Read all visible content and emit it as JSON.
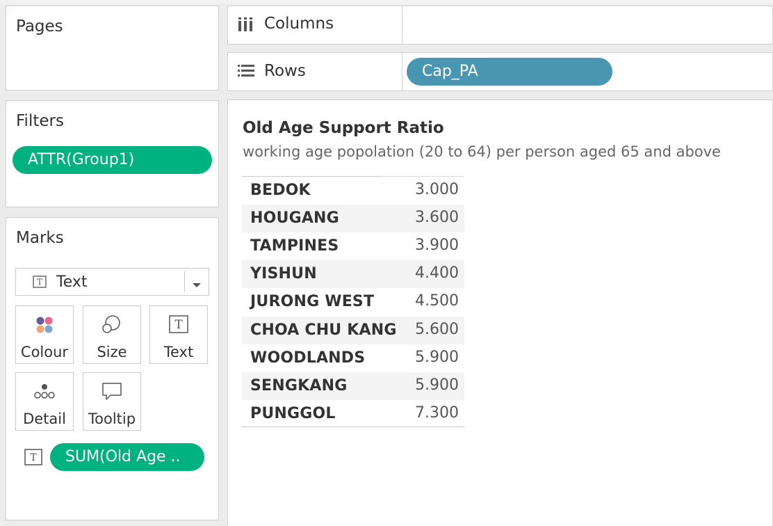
{
  "pages_panel": {
    "title": "Pages"
  },
  "filters_panel": {
    "title": "Filters",
    "pill": "ATTR(Group1)"
  },
  "marks_panel": {
    "title": "Marks",
    "mark_type": "Text",
    "cards": [
      "Colour",
      "Size",
      "Text",
      "Detail",
      "Tooltip"
    ],
    "field_pill": "SUM(Old Age .."
  },
  "shelves": {
    "columns_label": "Columns",
    "rows_label": "Rows",
    "rows_pill": "Cap_PA"
  },
  "view": {
    "title": "Old Age Support Ratio",
    "subtitle": "working age popolation (20 to 64) per person aged 65 and above"
  },
  "chart_data": {
    "type": "table",
    "title": "Old Age Support Ratio",
    "subtitle": "working age popolation (20 to 64) per person aged 65 and above",
    "categories": [
      "BEDOK",
      "HOUGANG",
      "TAMPINES",
      "YISHUN",
      "JURONG WEST",
      "CHOA CHU KANG",
      "WOODLANDS",
      "SENGKANG",
      "PUNGGOL"
    ],
    "values": [
      "3.000",
      "3.600",
      "3.900",
      "4.400",
      "4.500",
      "5.600",
      "5.900",
      "5.900",
      "7.300"
    ]
  },
  "colors": {
    "green_pill": "#00b280",
    "blue_pill": "#4996b2"
  }
}
